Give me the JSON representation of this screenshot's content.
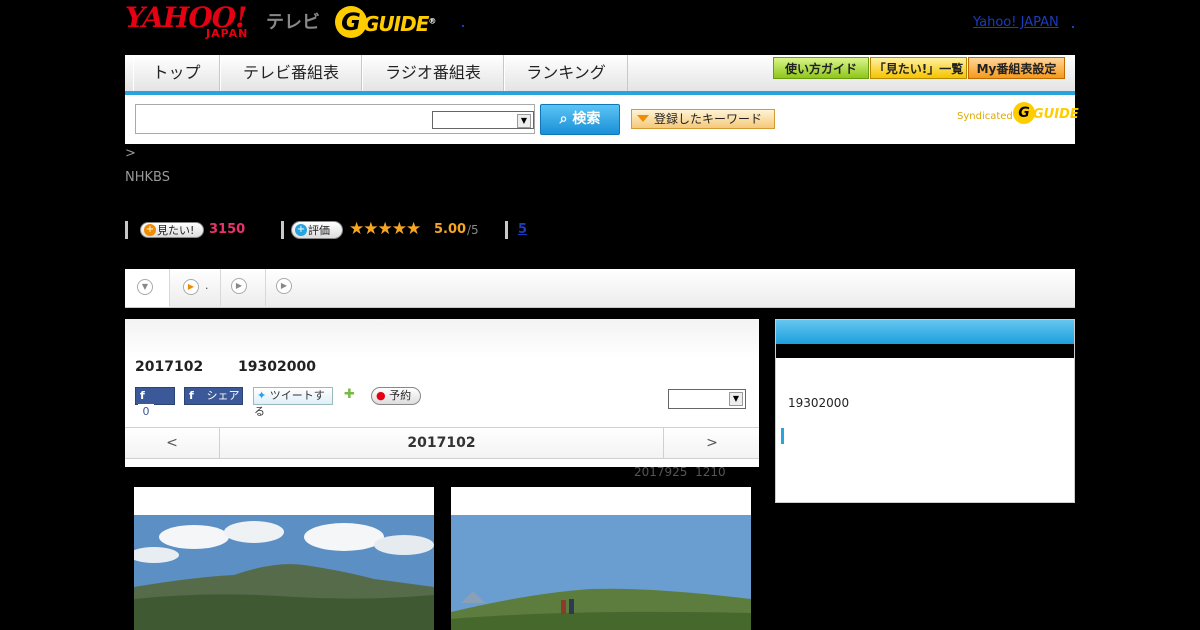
{
  "header": {
    "yahoo_logo": "YAHOO!",
    "japan_logo": "JAPAN",
    "tv_label": "テレビ",
    "gguide_logo": "G",
    "gguide_text": "GUIDE",
    "registered": "®",
    "yahoo_japan_link": "Yahoo! JAPAN"
  },
  "nav": {
    "tabs": [
      "トップ",
      "テレビ番組表",
      "ラジオ番組表",
      "ランキング"
    ],
    "buttons": [
      "使い方ガイド",
      "「見たい!」一覧",
      "My番組表設定"
    ]
  },
  "search": {
    "input_value": "",
    "select_value": "",
    "button_label": "検索",
    "keyword_button": "登録したキーワード",
    "syndicated": "Syndicated",
    "syndicated_guide": "GUIDE"
  },
  "breadcrumb": ">",
  "channel": "NHKBS",
  "stats": {
    "want_label": "見たい!",
    "want_count": "3150",
    "rating_label": "評価",
    "stars": "★★★★★",
    "rating_value": "5.00",
    "rating_max": "/5",
    "review_count": "5"
  },
  "tabs": {
    "second_label": "."
  },
  "program": {
    "date": "2017102",
    "time": "19302000",
    "fb_like_count": "0",
    "share_label": "シェア",
    "tweet_label": "ツイートする",
    "reserve_label": "予約",
    "select_value": ""
  },
  "day_nav": {
    "prev": "<",
    "current": "2017102",
    "next": ">"
  },
  "updated_note": "2017925  1210",
  "sidebar": {
    "time": "19302000"
  },
  "colors": {
    "accent": "#27a3dd",
    "rating": "#f5a623",
    "want": "#e8336d",
    "yahoo_red": "#e60012"
  }
}
